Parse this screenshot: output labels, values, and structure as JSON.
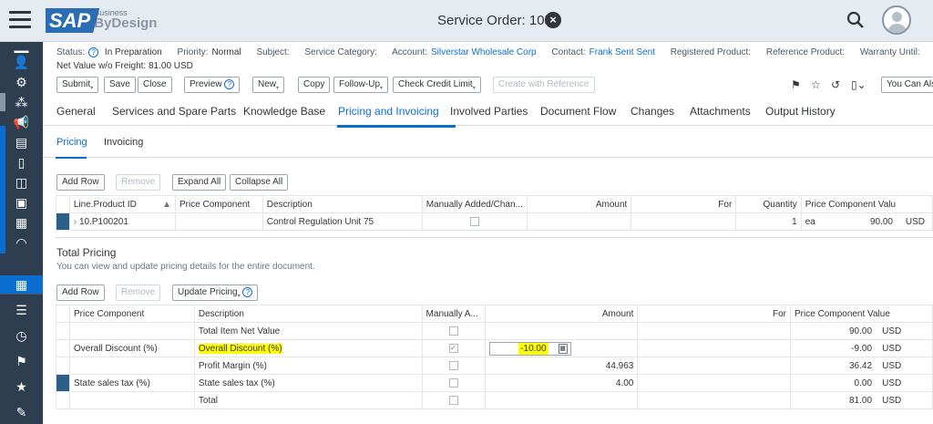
{
  "app": {
    "brand": "SAP",
    "brand_sub1": "Business",
    "brand_sub2": "ByDesign",
    "window_title": "Service Order: 1052"
  },
  "header": {
    "status_label": "Status:",
    "status_value": "In Preparation",
    "priority_label": "Priority:",
    "priority_value": "Normal",
    "subject_label": "Subject:",
    "service_category_label": "Service Category:",
    "account_label": "Account:",
    "account_value": "Silverstar Wholesale Corp",
    "contact_label": "Contact:",
    "contact_value": "Frank Sent Sent",
    "registered_product_label": "Registered Product:",
    "reference_product_label": "Reference Product:",
    "warranty_label": "Warranty Until:",
    "net_value_label": "Net Value w/o Freight:",
    "net_value": "81.00 USD"
  },
  "toolbar": {
    "submit": "Submit",
    "save": "Save",
    "close": "Close",
    "preview": "Preview",
    "new": "New",
    "copy": "Copy",
    "follow_up": "Follow-Up",
    "check_credit": "Check Credit Limit",
    "create_reference": "Create with Reference",
    "you_can_also": "You Can Als"
  },
  "tabs": [
    "General",
    "Services and Spare Parts",
    "Knowledge Base",
    "Pricing and Invoicing",
    "Involved Parties",
    "Document Flow",
    "Changes",
    "Attachments",
    "Output History"
  ],
  "subtabs": [
    "Pricing",
    "Invoicing"
  ],
  "item_pricing": {
    "add_row": "Add Row",
    "remove": "Remove",
    "expand_all": "Expand All",
    "collapse_all": "Collapse All",
    "columns": [
      "Line.Product ID",
      "Price Component",
      "Description",
      "Manually Added/Chan...",
      "Amount",
      "For",
      "Quantity",
      "Price Component Valu"
    ],
    "row": {
      "line_product": "10.P100201",
      "description": "Control Regulation Unit 75",
      "quantity": "1",
      "unit": "ea",
      "value": "90.00",
      "currency": "USD"
    }
  },
  "total_pricing": {
    "title": "Total Pricing",
    "description": "You can view and update pricing details for the entire document.",
    "add_row": "Add Row",
    "remove": "Remove",
    "update_pricing": "Update Pricing",
    "columns": [
      "Price Component",
      "Description",
      "Manually A...",
      "Amount",
      "For",
      "Price Component Value"
    ],
    "rows": [
      {
        "component": "",
        "description": "Total Item Net Value",
        "amount": "",
        "value": "90.00",
        "currency": "USD",
        "checked": false
      },
      {
        "component": "Overall Discount (%)",
        "description": "Overall Discount (%)",
        "amount": "-10.00",
        "value": "-9.00",
        "currency": "USD",
        "checked": true
      },
      {
        "component": "",
        "description": "Profit Margin (%)",
        "amount": "44.963",
        "value": "36.42",
        "currency": "USD",
        "checked": false
      },
      {
        "component": "State sales tax (%)",
        "description": "State sales tax (%)",
        "amount": "4.00",
        "value": "0.00",
        "currency": "USD",
        "checked": false
      },
      {
        "component": "",
        "description": "Total",
        "amount": "",
        "value": "81.00",
        "currency": "USD",
        "checked": false
      }
    ]
  },
  "colors": {
    "shell_bg": "#e5ebf1",
    "sidebar_bg": "#2c3e50",
    "accent": "#0a6ed1",
    "highlight": "#ffff00"
  }
}
